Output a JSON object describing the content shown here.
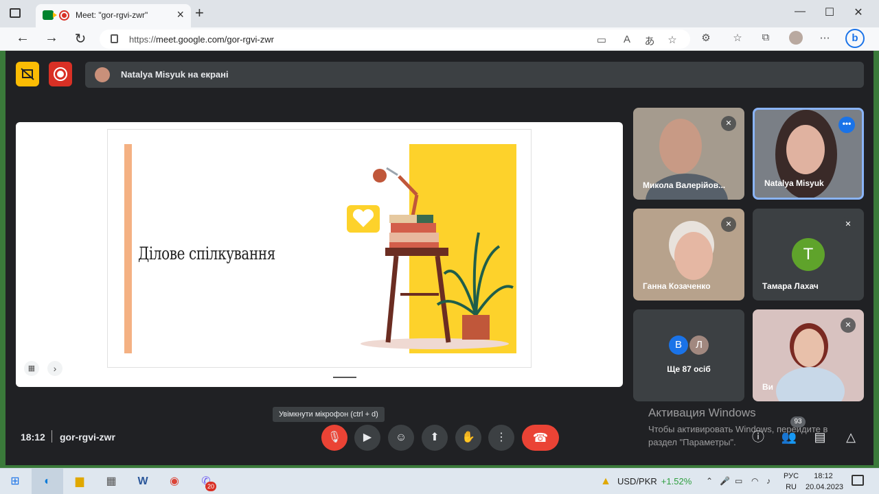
{
  "browser": {
    "tab_title": "Meet: \"gor-rgvi-zwr\"",
    "url_prefix": "https://",
    "url_main": "meet.google.com/gor-rgvi-zwr"
  },
  "meet": {
    "presenting_label": "Natalya Misyuk на екрані",
    "slide": {
      "title": "Ділове спілкування"
    },
    "participants": [
      {
        "name": "Микола Валерійов...",
        "muted": true
      },
      {
        "name": "Natalya Misyuk",
        "muted": false,
        "active": true
      },
      {
        "name": "Ганна Козаченко",
        "muted": true
      },
      {
        "name": "Тамара Лахач",
        "muted": true,
        "initial": "T"
      },
      {
        "name": "Ще 87 осіб",
        "initials": [
          "В",
          "Л"
        ]
      },
      {
        "name": "Ви",
        "muted": true
      }
    ],
    "tooltip": "Увімкнути мікрофон (ctrl + d)",
    "time": "18:12",
    "meeting_code": "gor-rgvi-zwr",
    "people_count": "93",
    "watermark_title": "Активация Windows",
    "watermark_text": "Чтобы активировать Windows, перейдите в раздел \"Параметры\"."
  },
  "taskbar": {
    "ticker_symbol": "USD/PKR",
    "ticker_change": "+1.52%",
    "lang_top": "РУС",
    "lang_bottom": "RU",
    "time": "18:12",
    "date": "20.04.2023",
    "viber_badge": "20"
  },
  "colors": {
    "meet_bg": "#202124",
    "accent_blue": "#1a73e8",
    "end_call_red": "#ea4335",
    "slide_yellow": "#fdd22b",
    "slide_stripe": "#f4b183"
  }
}
